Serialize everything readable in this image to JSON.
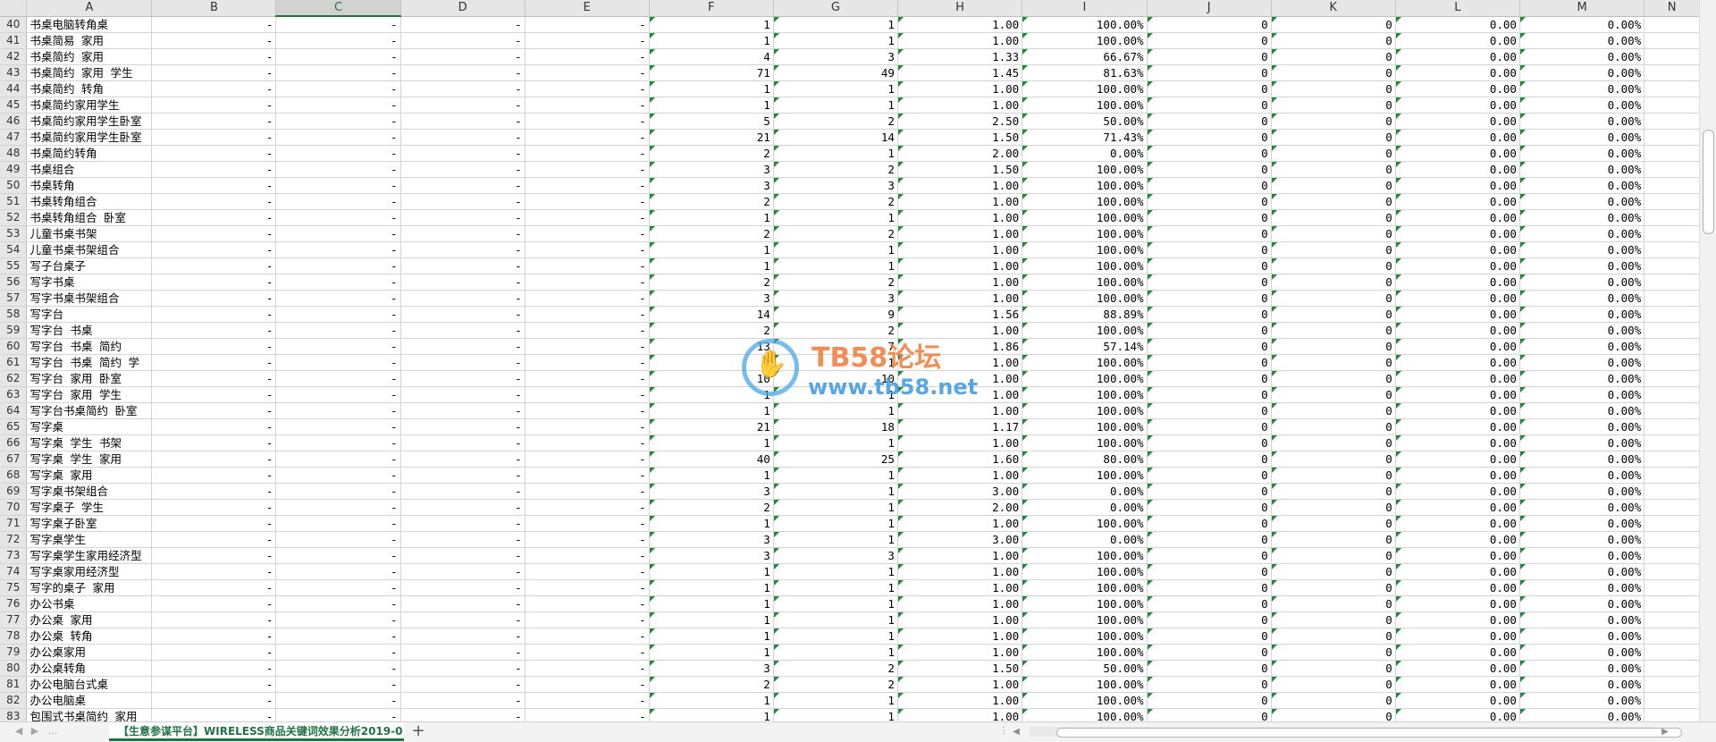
{
  "sheet": {
    "columns": [
      "A",
      "B",
      "C",
      "D",
      "E",
      "F",
      "G",
      "H",
      "I",
      "J",
      "K",
      "L",
      "M",
      "N"
    ],
    "selected_column": "C",
    "rows": [
      {
        "n": "40",
        "a": "书桌电脑转角桌",
        "f": "1",
        "g": "1",
        "h": "1.00",
        "i": "100.00%",
        "j": "0",
        "k": "0",
        "l": "0.00",
        "m": "0.00%"
      },
      {
        "n": "41",
        "a": "书桌简易 家用",
        "f": "1",
        "g": "1",
        "h": "1.00",
        "i": "100.00%",
        "j": "0",
        "k": "0",
        "l": "0.00",
        "m": "0.00%"
      },
      {
        "n": "42",
        "a": "书桌简约 家用",
        "f": "4",
        "g": "3",
        "h": "1.33",
        "i": "66.67%",
        "j": "0",
        "k": "0",
        "l": "0.00",
        "m": "0.00%"
      },
      {
        "n": "43",
        "a": "书桌简约 家用 学生",
        "f": "71",
        "g": "49",
        "h": "1.45",
        "i": "81.63%",
        "j": "0",
        "k": "0",
        "l": "0.00",
        "m": "0.00%"
      },
      {
        "n": "44",
        "a": "书桌简约 转角",
        "f": "1",
        "g": "1",
        "h": "1.00",
        "i": "100.00%",
        "j": "0",
        "k": "0",
        "l": "0.00",
        "m": "0.00%"
      },
      {
        "n": "45",
        "a": "书桌简约家用学生",
        "f": "1",
        "g": "1",
        "h": "1.00",
        "i": "100.00%",
        "j": "0",
        "k": "0",
        "l": "0.00",
        "m": "0.00%"
      },
      {
        "n": "46",
        "a": "书桌简约家用学生卧室",
        "f": "5",
        "g": "2",
        "h": "2.50",
        "i": "50.00%",
        "j": "0",
        "k": "0",
        "l": "0.00",
        "m": "0.00%"
      },
      {
        "n": "47",
        "a": "书桌简约家用学生卧室",
        "f": "21",
        "g": "14",
        "h": "1.50",
        "i": "71.43%",
        "j": "0",
        "k": "0",
        "l": "0.00",
        "m": "0.00%"
      },
      {
        "n": "48",
        "a": "书桌简约转角",
        "f": "2",
        "g": "1",
        "h": "2.00",
        "i": "0.00%",
        "j": "0",
        "k": "0",
        "l": "0.00",
        "m": "0.00%"
      },
      {
        "n": "49",
        "a": "书桌组合",
        "f": "3",
        "g": "2",
        "h": "1.50",
        "i": "100.00%",
        "j": "0",
        "k": "0",
        "l": "0.00",
        "m": "0.00%"
      },
      {
        "n": "50",
        "a": "书桌转角",
        "f": "3",
        "g": "3",
        "h": "1.00",
        "i": "100.00%",
        "j": "0",
        "k": "0",
        "l": "0.00",
        "m": "0.00%"
      },
      {
        "n": "51",
        "a": "书桌转角组合",
        "f": "2",
        "g": "2",
        "h": "1.00",
        "i": "100.00%",
        "j": "0",
        "k": "0",
        "l": "0.00",
        "m": "0.00%"
      },
      {
        "n": "52",
        "a": "书桌转角组合 卧室",
        "f": "1",
        "g": "1",
        "h": "1.00",
        "i": "100.00%",
        "j": "0",
        "k": "0",
        "l": "0.00",
        "m": "0.00%"
      },
      {
        "n": "53",
        "a": "儿童书桌书架",
        "f": "2",
        "g": "2",
        "h": "1.00",
        "i": "100.00%",
        "j": "0",
        "k": "0",
        "l": "0.00",
        "m": "0.00%"
      },
      {
        "n": "54",
        "a": "儿童书桌书架组合",
        "f": "1",
        "g": "1",
        "h": "1.00",
        "i": "100.00%",
        "j": "0",
        "k": "0",
        "l": "0.00",
        "m": "0.00%"
      },
      {
        "n": "55",
        "a": "写子台桌子",
        "f": "1",
        "g": "1",
        "h": "1.00",
        "i": "100.00%",
        "j": "0",
        "k": "0",
        "l": "0.00",
        "m": "0.00%"
      },
      {
        "n": "56",
        "a": "写字书桌",
        "f": "2",
        "g": "2",
        "h": "1.00",
        "i": "100.00%",
        "j": "0",
        "k": "0",
        "l": "0.00",
        "m": "0.00%"
      },
      {
        "n": "57",
        "a": "写字书桌书架组合",
        "f": "3",
        "g": "3",
        "h": "1.00",
        "i": "100.00%",
        "j": "0",
        "k": "0",
        "l": "0.00",
        "m": "0.00%"
      },
      {
        "n": "58",
        "a": "写字台",
        "f": "14",
        "g": "9",
        "h": "1.56",
        "i": "88.89%",
        "j": "0",
        "k": "0",
        "l": "0.00",
        "m": "0.00%"
      },
      {
        "n": "59",
        "a": "写字台 书桌",
        "f": "2",
        "g": "2",
        "h": "1.00",
        "i": "100.00%",
        "j": "0",
        "k": "0",
        "l": "0.00",
        "m": "0.00%"
      },
      {
        "n": "60",
        "a": "写字台 书桌 简约",
        "f": "13",
        "g": "7",
        "h": "1.86",
        "i": "57.14%",
        "j": "0",
        "k": "0",
        "l": "0.00",
        "m": "0.00%"
      },
      {
        "n": "61",
        "a": "写字台 书桌 简约 学",
        "f": "1",
        "g": "1",
        "h": "1.00",
        "i": "100.00%",
        "j": "0",
        "k": "0",
        "l": "0.00",
        "m": "0.00%"
      },
      {
        "n": "62",
        "a": "写字台 家用 卧室",
        "f": "10",
        "g": "10",
        "h": "1.00",
        "i": "100.00%",
        "j": "0",
        "k": "0",
        "l": "0.00",
        "m": "0.00%"
      },
      {
        "n": "63",
        "a": "写字台 家用 学生",
        "f": "1",
        "g": "1",
        "h": "1.00",
        "i": "100.00%",
        "j": "0",
        "k": "0",
        "l": "0.00",
        "m": "0.00%"
      },
      {
        "n": "64",
        "a": "写字台书桌简约 卧室",
        "f": "1",
        "g": "1",
        "h": "1.00",
        "i": "100.00%",
        "j": "0",
        "k": "0",
        "l": "0.00",
        "m": "0.00%"
      },
      {
        "n": "65",
        "a": "写字桌",
        "f": "21",
        "g": "18",
        "h": "1.17",
        "i": "100.00%",
        "j": "0",
        "k": "0",
        "l": "0.00",
        "m": "0.00%"
      },
      {
        "n": "66",
        "a": "写字桌 学生 书架",
        "f": "1",
        "g": "1",
        "h": "1.00",
        "i": "100.00%",
        "j": "0",
        "k": "0",
        "l": "0.00",
        "m": "0.00%"
      },
      {
        "n": "67",
        "a": "写字桌 学生 家用",
        "f": "40",
        "g": "25",
        "h": "1.60",
        "i": "80.00%",
        "j": "0",
        "k": "0",
        "l": "0.00",
        "m": "0.00%"
      },
      {
        "n": "68",
        "a": "写字桌 家用",
        "f": "1",
        "g": "1",
        "h": "1.00",
        "i": "100.00%",
        "j": "0",
        "k": "0",
        "l": "0.00",
        "m": "0.00%"
      },
      {
        "n": "69",
        "a": "写字桌书架组合",
        "f": "3",
        "g": "1",
        "h": "3.00",
        "i": "0.00%",
        "j": "0",
        "k": "0",
        "l": "0.00",
        "m": "0.00%"
      },
      {
        "n": "70",
        "a": "写字桌子 学生",
        "f": "2",
        "g": "1",
        "h": "2.00",
        "i": "0.00%",
        "j": "0",
        "k": "0",
        "l": "0.00",
        "m": "0.00%"
      },
      {
        "n": "71",
        "a": "写字桌子卧室",
        "f": "1",
        "g": "1",
        "h": "1.00",
        "i": "100.00%",
        "j": "0",
        "k": "0",
        "l": "0.00",
        "m": "0.00%"
      },
      {
        "n": "72",
        "a": "写字桌学生",
        "f": "3",
        "g": "1",
        "h": "3.00",
        "i": "0.00%",
        "j": "0",
        "k": "0",
        "l": "0.00",
        "m": "0.00%"
      },
      {
        "n": "73",
        "a": "写字桌学生家用经济型",
        "f": "3",
        "g": "3",
        "h": "1.00",
        "i": "100.00%",
        "j": "0",
        "k": "0",
        "l": "0.00",
        "m": "0.00%"
      },
      {
        "n": "74",
        "a": "写字桌家用经济型",
        "f": "1",
        "g": "1",
        "h": "1.00",
        "i": "100.00%",
        "j": "0",
        "k": "0",
        "l": "0.00",
        "m": "0.00%"
      },
      {
        "n": "75",
        "a": "写字的桌子 家用",
        "f": "1",
        "g": "1",
        "h": "1.00",
        "i": "100.00%",
        "j": "0",
        "k": "0",
        "l": "0.00",
        "m": "0.00%"
      },
      {
        "n": "76",
        "a": "办公书桌",
        "f": "1",
        "g": "1",
        "h": "1.00",
        "i": "100.00%",
        "j": "0",
        "k": "0",
        "l": "0.00",
        "m": "0.00%"
      },
      {
        "n": "77",
        "a": "办公桌 家用",
        "f": "1",
        "g": "1",
        "h": "1.00",
        "i": "100.00%",
        "j": "0",
        "k": "0",
        "l": "0.00",
        "m": "0.00%"
      },
      {
        "n": "78",
        "a": "办公桌 转角",
        "f": "1",
        "g": "1",
        "h": "1.00",
        "i": "100.00%",
        "j": "0",
        "k": "0",
        "l": "0.00",
        "m": "0.00%"
      },
      {
        "n": "79",
        "a": "办公桌家用",
        "f": "1",
        "g": "1",
        "h": "1.00",
        "i": "100.00%",
        "j": "0",
        "k": "0",
        "l": "0.00",
        "m": "0.00%"
      },
      {
        "n": "80",
        "a": "办公桌转角",
        "f": "3",
        "g": "2",
        "h": "1.50",
        "i": "50.00%",
        "j": "0",
        "k": "0",
        "l": "0.00",
        "m": "0.00%"
      },
      {
        "n": "81",
        "a": "办公电脑台式桌",
        "f": "2",
        "g": "2",
        "h": "1.00",
        "i": "100.00%",
        "j": "0",
        "k": "0",
        "l": "0.00",
        "m": "0.00%"
      },
      {
        "n": "82",
        "a": "办公电脑桌",
        "f": "1",
        "g": "1",
        "h": "1.00",
        "i": "100.00%",
        "j": "0",
        "k": "0",
        "l": "0.00",
        "m": "0.00%"
      },
      {
        "n": "83",
        "a": "包围式书桌简约 家用",
        "f": "1",
        "g": "1",
        "h": "1.00",
        "i": "100.00%",
        "j": "0",
        "k": "0",
        "l": "0.00",
        "m": "0.00%"
      }
    ],
    "dash": "-"
  },
  "tabs": {
    "active_label": "【生意参谋平台】WIRELESS商品关键词效果分析2019-0",
    "add_symbol": "+"
  },
  "watermark": {
    "title": "TB58论坛",
    "url": "www.tb58.net"
  },
  "colors": {
    "accent": "#217346",
    "flag": "#1f8a3a"
  }
}
